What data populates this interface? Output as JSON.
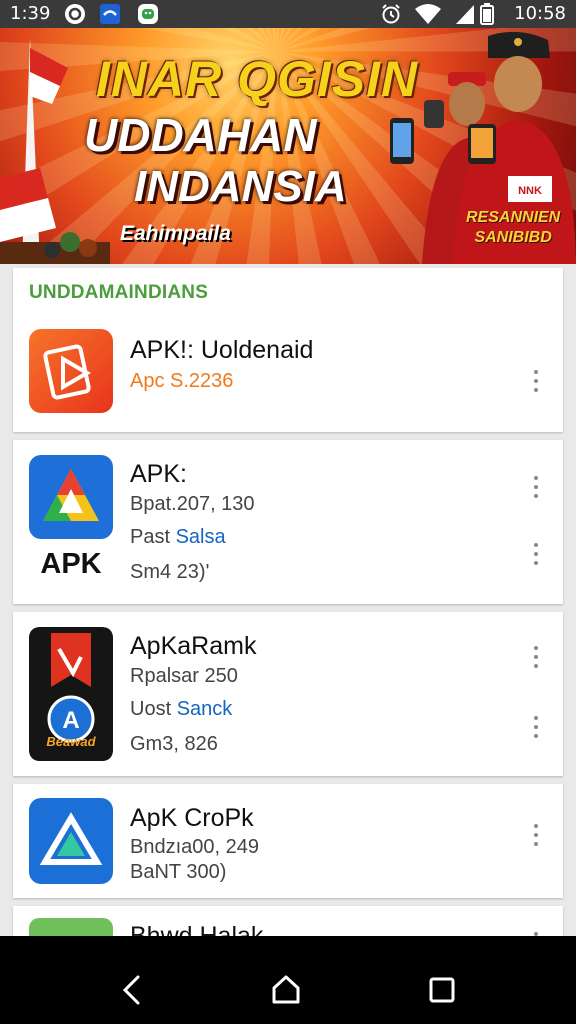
{
  "status_bar": {
    "time": "1:39",
    "clock_right": "10:58",
    "icons_left": [
      "sync-icon",
      "message-icon",
      "android-icon"
    ],
    "icons_right": [
      "alarm-icon",
      "wifi-icon",
      "signal-icon",
      "battery-icon"
    ]
  },
  "banner": {
    "title1": "INAR QGISIN",
    "title2": "UDDAHAN",
    "title3": "INDANSIA",
    "subtitle": "Eahimpaila",
    "side_line1": "RESANNIEN",
    "side_line2": "SANIBIBD",
    "shirt_tag": "NNK"
  },
  "section": {
    "title": "UNDDAMAINDIANS"
  },
  "apps": [
    {
      "name": "APK!: Uoldenaid",
      "line1": "Apc S.2236",
      "icon": "play-card-icon",
      "colors": [
        "#f05a22",
        "#e63b1e"
      ]
    },
    {
      "name": "APK:",
      "line1": "Bpat.207, 130",
      "line2_prefix": "Past",
      "line2_link": "Salsa",
      "line3": "Sm4 23)'",
      "icon_caption": "APK",
      "icon": "triangle-logo-icon"
    },
    {
      "name": "ApKaRamk",
      "line1": "Rpalsar 250",
      "line2_prefix": "Uost",
      "line2_link": "Sanck",
      "line3": "Gm3, 826",
      "icon_caption": "Beawad",
      "icon": "ribbon-a-logo-icon"
    },
    {
      "name": "ApK CroPk",
      "line1": "Bndzıa00, 249",
      "line2": "BaNT 300)",
      "icon": "blue-triangle-icon"
    },
    {
      "name": "Bhwd Halak",
      "icon": "green-app-icon"
    }
  ],
  "nav": {
    "back": "back-icon",
    "home": "home-icon",
    "recents": "recents-icon"
  },
  "colors": {
    "accent_green": "#4a9e3c",
    "link_blue": "#1565c0",
    "status_bar": "#3a3a3a"
  }
}
